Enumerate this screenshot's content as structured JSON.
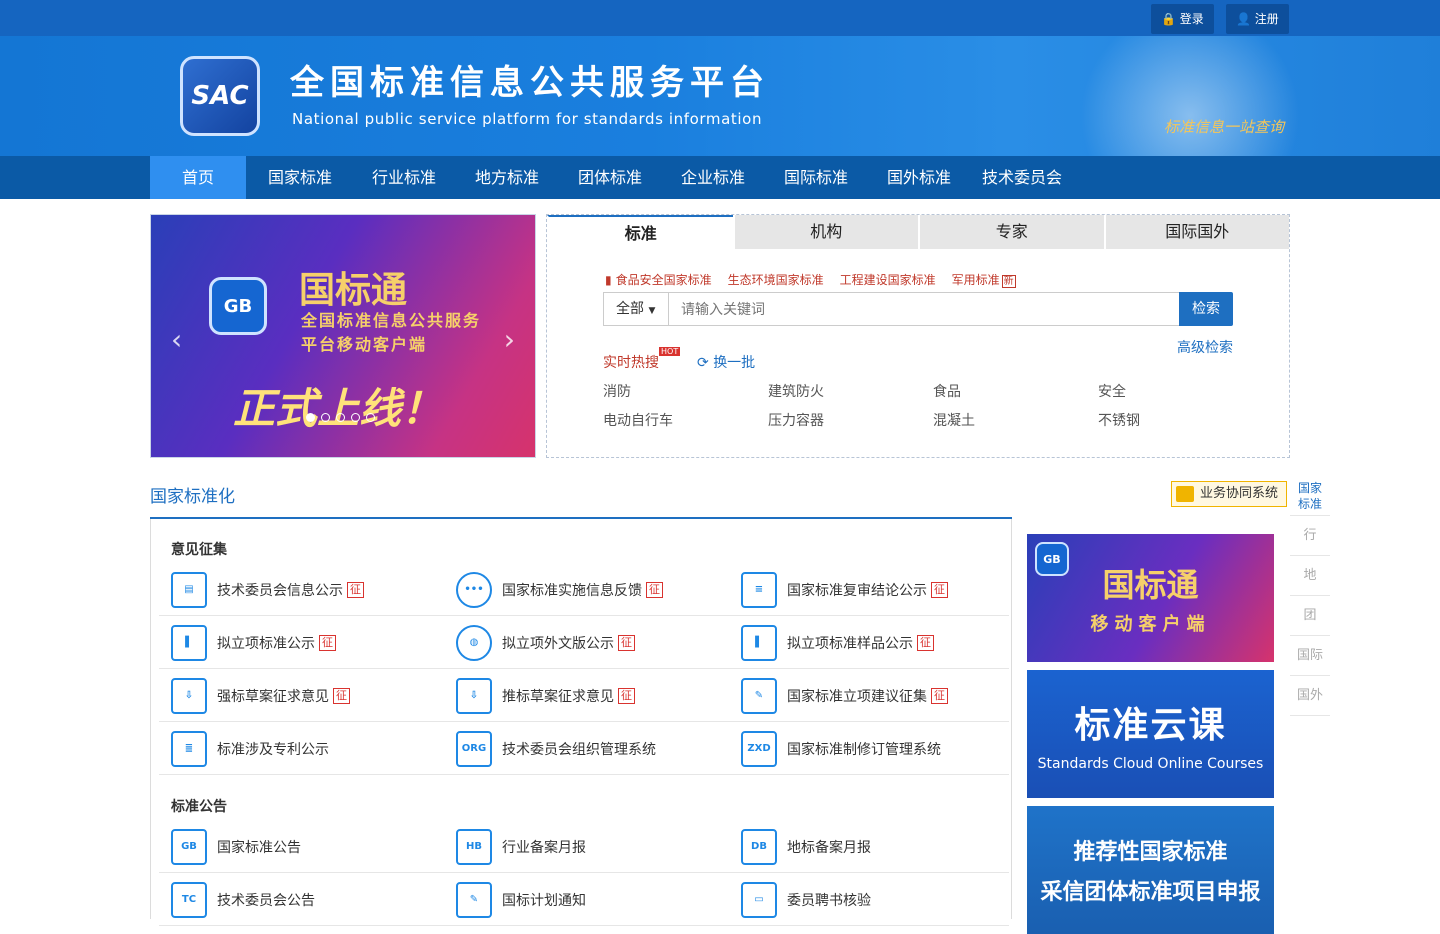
{
  "topbar": {
    "login": "登录",
    "register": "注册"
  },
  "header": {
    "logo_text": "SAC",
    "title_cn": "全国标准信息公共服务平台",
    "title_en": "National public service platform  for standards information",
    "slogan": "标准信息一站查询"
  },
  "nav": {
    "items": [
      "首页",
      "国家标准",
      "行业标准",
      "地方标准",
      "团体标准",
      "企业标准",
      "国际标准",
      "国外标准",
      "技术委员会"
    ],
    "active": 0
  },
  "banner": {
    "app_icon": "GB",
    "line1": "国标通",
    "line2": "全国标准信息公共服务",
    "line3": "平台移动客户端",
    "line4": "正式上线！",
    "dots": 5
  },
  "search": {
    "tabs": [
      "标准",
      "机构",
      "专家",
      "国际国外"
    ],
    "quick_links": [
      "食品安全国家标准",
      "生态环境国家标准",
      "工程建设国家标准",
      "军用标准"
    ],
    "new_badge": "新",
    "select_value": "全部",
    "placeholder": "请输入关键词",
    "button": "检索",
    "advanced": "高级检索",
    "hot_label": "实时热搜",
    "hot_badge": "HOT",
    "refresh": "换一批",
    "hot_terms": [
      "消防",
      "建筑防火",
      "食品",
      "安全",
      "电动自行车",
      "压力容器",
      "混凝土",
      "不锈钢"
    ]
  },
  "section": {
    "title": "国家标准化",
    "biz_button": "业务协同系统",
    "opinion_title": "意见征集",
    "announce_title": "标准公告",
    "zheng": "征",
    "opinion_rows": [
      [
        "技术委员会信息公示",
        "国家标准实施信息反馈",
        "国家标准复审结论公示"
      ],
      [
        "拟立项标准公示",
        "拟立项外文版公示",
        "拟立项标准样品公示"
      ],
      [
        "强标草案征求意见",
        "推标草案征求意见",
        "国家标准立项建议征集"
      ],
      [
        "标准涉及专利公示",
        "技术委员会组织管理系统",
        "国家标准制修订管理系统"
      ]
    ],
    "announce_rows": [
      [
        "国家标准公告",
        "行业备案月报",
        "地标备案月报"
      ],
      [
        "技术委员会公告",
        "国标计划通知",
        "委员聘书核验"
      ]
    ],
    "icon_labels": [
      "GB",
      "HB",
      "DB",
      "TC",
      "ORG",
      "ZXD"
    ]
  },
  "promos": [
    {
      "line1": "国标通",
      "line2": "移动客户端",
      "icon": "GB"
    },
    {
      "line1": "标准云课",
      "line2": "Standards Cloud Online Courses"
    },
    {
      "line1": "推荐性国家标准",
      "line2": "采信团体标准项目申报"
    }
  ],
  "sidenav": [
    {
      "label": "国家\n标准"
    },
    {
      "label": "行"
    },
    {
      "label": "地"
    },
    {
      "label": "团"
    },
    {
      "label": "国际"
    },
    {
      "label": "国外"
    }
  ],
  "colors": {
    "brand": "#1e6fc1",
    "nav": "#0b5aa6",
    "nav_active": "#2f8ff0",
    "accent_red": "#d9332f"
  }
}
